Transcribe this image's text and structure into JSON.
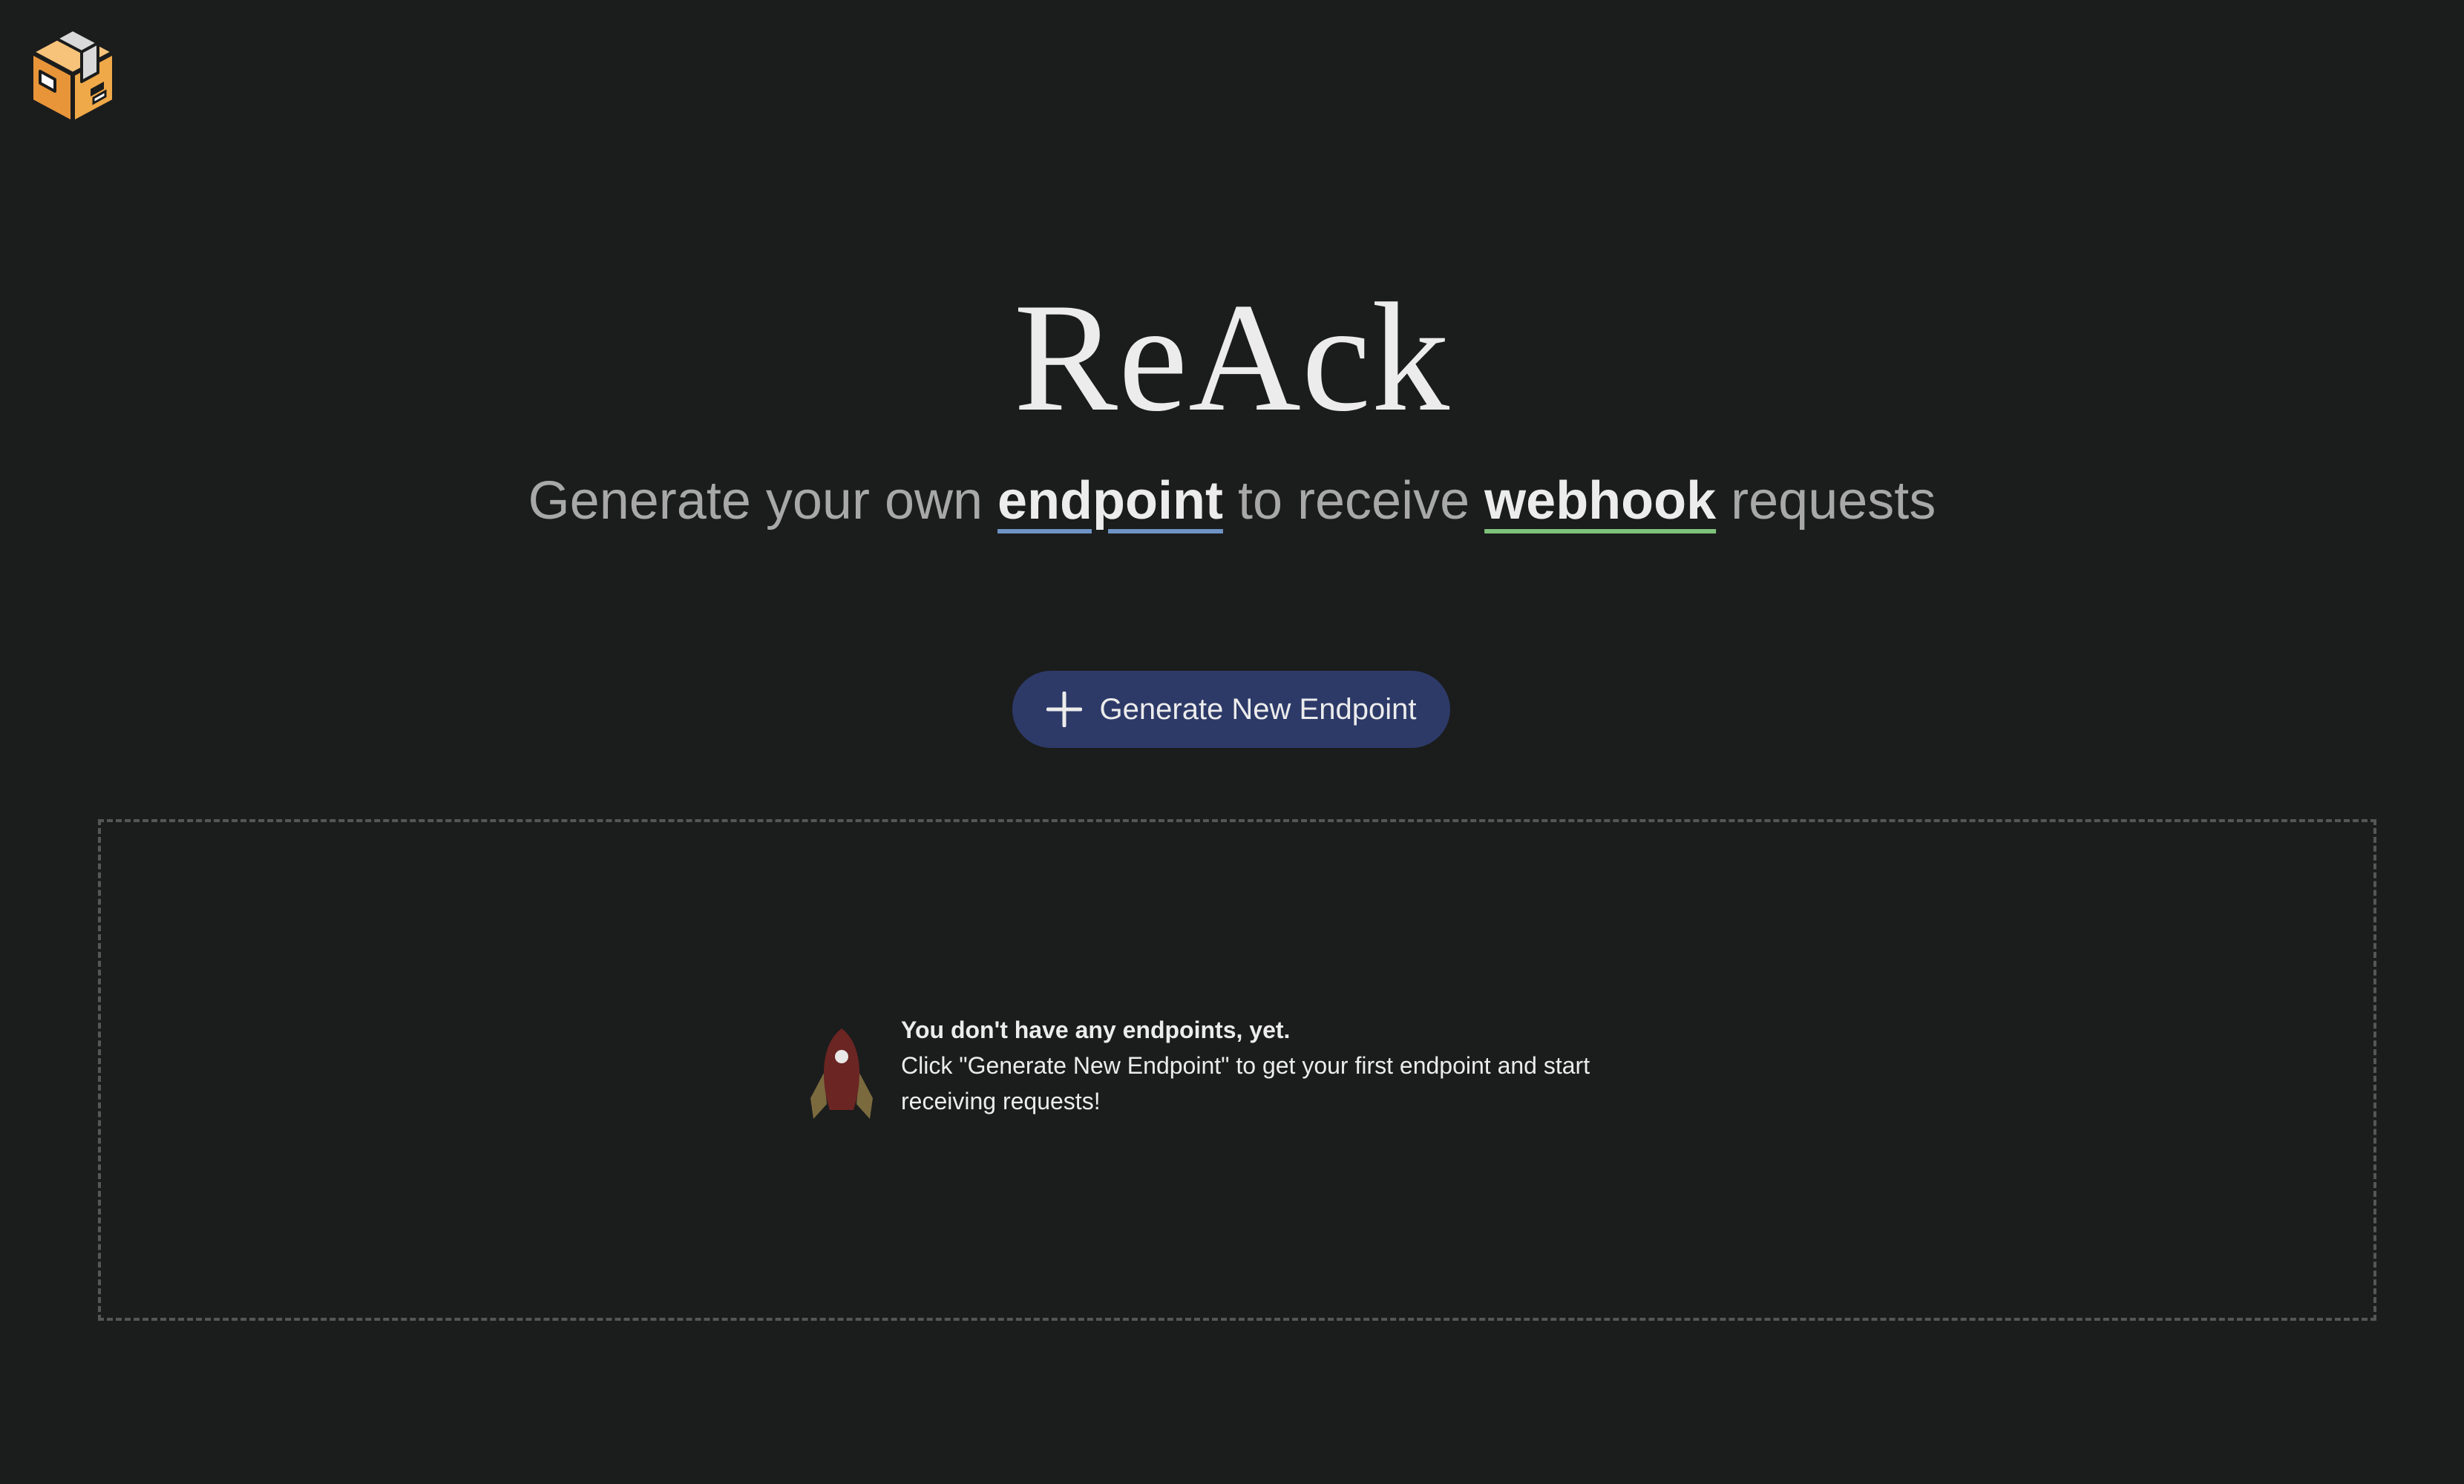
{
  "app": {
    "logo_icon": "package-box-icon"
  },
  "hero": {
    "title": "ReAck",
    "subtitle": {
      "part1": "Generate your own ",
      "highlight1": "endpoint",
      "part2": " to receive ",
      "highlight2": "webhook",
      "part3": " requests"
    }
  },
  "actions": {
    "generate_label": "Generate New Endpoint",
    "generate_icon": "plus-icon"
  },
  "empty_state": {
    "icon": "rocket-icon",
    "headline": "You don't have any endpoints, yet.",
    "body": "Click \"Generate New Endpoint\" to get your first endpoint and start receiving requests!"
  },
  "colors": {
    "background": "#1b1c1c",
    "button": "#2d3a68",
    "endpoint_underline": "#6e93c4",
    "webhook_underline": "#7ec37a",
    "logo_orange": "#f0a948",
    "rocket_body": "#6b2523"
  }
}
